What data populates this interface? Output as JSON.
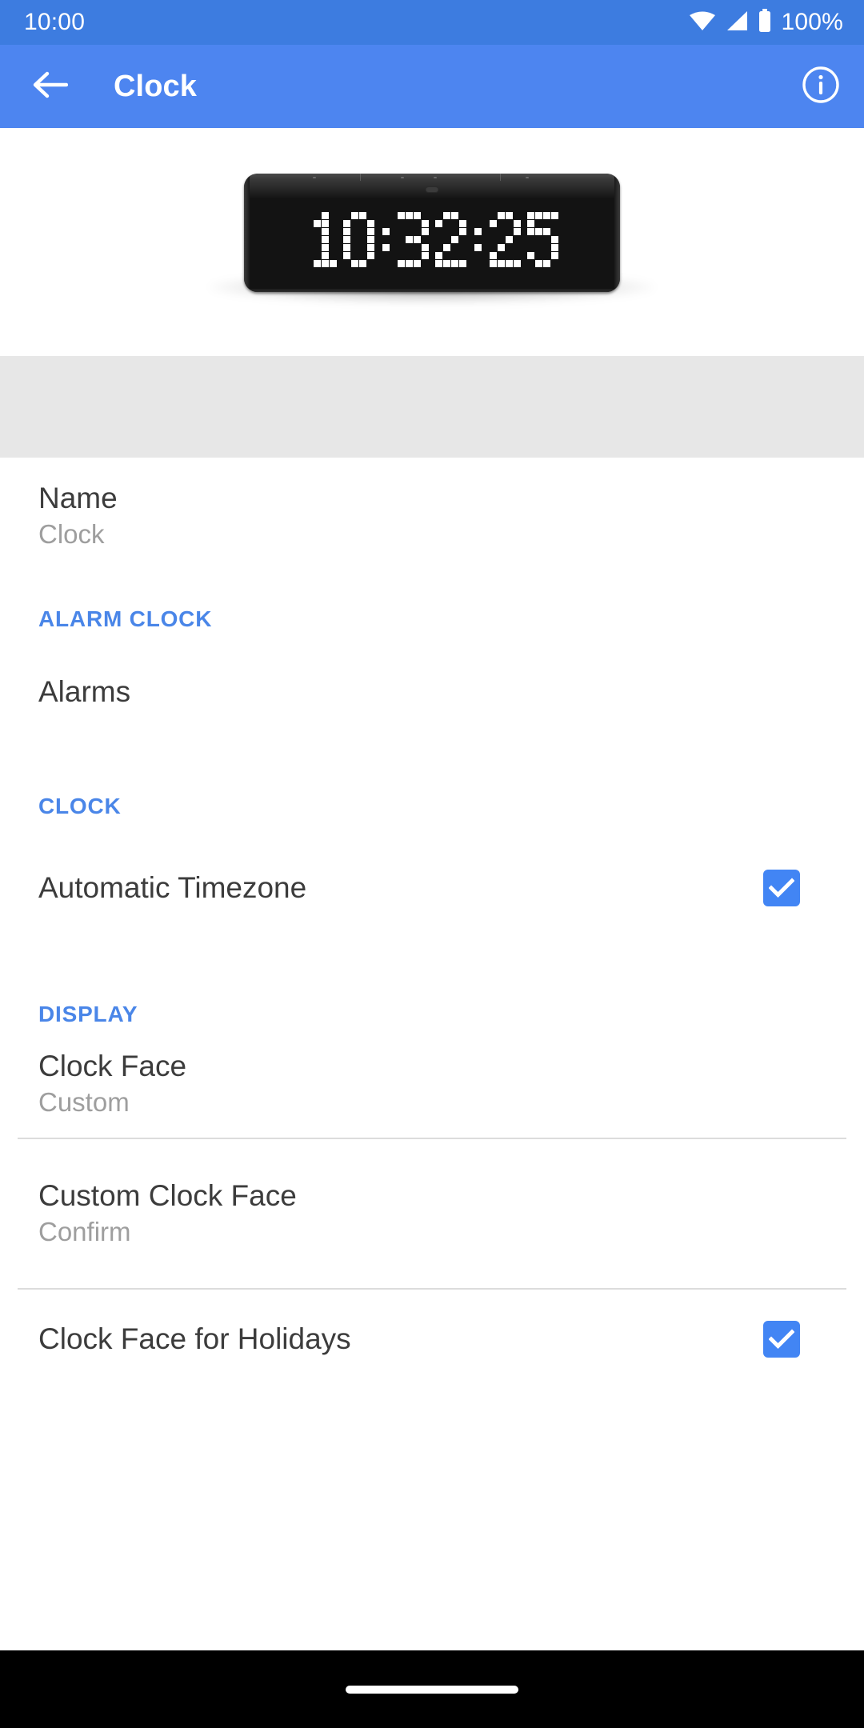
{
  "status_bar": {
    "time": "10:00",
    "battery_label": "100%",
    "icons": [
      "wifi-icon",
      "cell-signal-icon",
      "battery-icon"
    ]
  },
  "app_bar": {
    "title": "Clock",
    "back_icon": "back-arrow-icon",
    "info_icon": "info-circle-icon"
  },
  "hero": {
    "device": "lametric-clock-device",
    "display_time": "10:32:25"
  },
  "colors": {
    "status_bar_bg": "#3d7ce0",
    "app_bar_bg": "#4d85f0",
    "section_header": "#4a86e8",
    "checkbox_accent": "#4285f4",
    "gray_band": "#e7e7e7",
    "title_text": "#3c3c3c",
    "subtitle_text": "#9e9e9e",
    "divider": "#dcdcdc"
  },
  "settings": {
    "name_row": {
      "title": "Name",
      "value": "Clock"
    },
    "sections": [
      {
        "header": "ALARM CLOCK",
        "rows": [
          {
            "title": "Alarms"
          }
        ]
      },
      {
        "header": "CLOCK",
        "rows": [
          {
            "title": "Automatic Timezone",
            "checked": true
          }
        ]
      },
      {
        "header": "DISPLAY",
        "rows": [
          {
            "title": "Clock Face",
            "value": "Custom"
          },
          {
            "title": "Custom Clock Face",
            "value": "Confirm"
          },
          {
            "title": "Clock Face for Holidays",
            "checked": true
          }
        ]
      }
    ]
  },
  "nav_bar": {
    "handle": "gesture-home-handle"
  }
}
